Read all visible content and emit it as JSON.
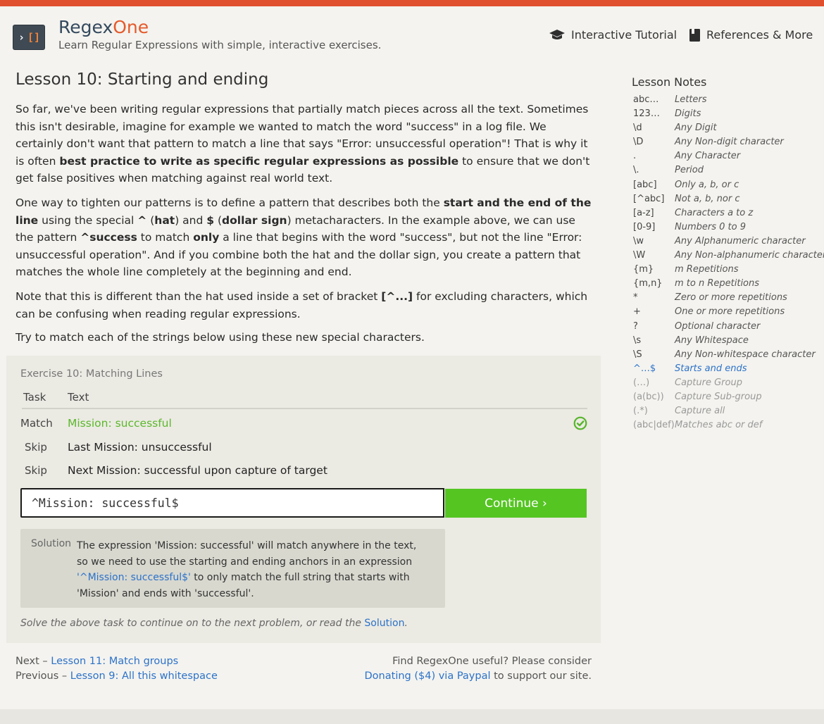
{
  "header": {
    "brand_main": "Regex",
    "brand_accent": "One",
    "tagline": "Learn Regular Expressions with simple, interactive exercises.",
    "nav": {
      "tutorial": "Interactive Tutorial",
      "references": "References & More"
    }
  },
  "lesson": {
    "title": "Lesson 10: Starting and ending",
    "p1": {
      "a": "So far, we've been writing regular expressions that partially match pieces across all the text. Sometimes this isn't desirable, imagine for example we wanted to match the word \"success\" in a log file. We certainly don't want that pattern to match a line that says \"Error: unsuccessful operation\"! That is why it is often ",
      "b": "best practice to write as specific regular expressions as possible",
      "c": " to ensure that we don't get false positives when matching against real world text."
    },
    "p2": {
      "a": "One way to tighten our patterns is to define a pattern that describes both the ",
      "b": "start and the end of the line",
      "c": " using the special ",
      "d": "^",
      "e": " (",
      "f": "hat",
      "g": ") and ",
      "h": "$",
      "i": " (",
      "j": "dollar sign",
      "k": ") metacharacters. In the example above, we can use the pattern ",
      "l": "^success",
      "m": " to match ",
      "n": "only",
      "o": " a line that begins with the word \"success\", but not the line \"Error: unsuccessful operation\". And if you combine both the hat and the dollar sign, you create a pattern that matches the whole line completely at the beginning and end."
    },
    "p3": {
      "a": "Note that this is different than the hat used inside a set of bracket ",
      "b": "[^...]",
      "c": " for excluding characters, which can be confusing when reading regular expressions."
    },
    "p4": "Try to match each of the strings below using these new special characters."
  },
  "exercise": {
    "title": "Exercise 10: Matching Lines",
    "col_task": "Task",
    "col_text": "Text",
    "rows": [
      {
        "task": "Match",
        "text": "Mission: successful",
        "status": "matched"
      },
      {
        "task": "Skip",
        "text": "Last Mission: unsuccessful"
      },
      {
        "task": "Skip",
        "text": "Next Mission: successful upon capture of target"
      }
    ],
    "input_value": "^Mission: successful$",
    "continue_label": "Continue ›",
    "solution": {
      "label": "Solution",
      "a": "The expression 'Mission: successful' will match anywhere in the text, so we need to use the starting and ending anchors in an expression ",
      "code": "'^Mission: successful$'",
      "b": " to only match the full string that starts with 'Mission' and ends with 'successful'."
    },
    "hint_text": "Solve the above task to continue on to the next problem, or read the ",
    "hint_link": "Solution",
    "hint_end": "."
  },
  "footer": {
    "next_prefix": "Next – ",
    "next_link": "Lesson 11: Match groups",
    "prev_prefix": "Previous – ",
    "prev_link": "Lesson 9: All this whitespace",
    "donate_line1": "Find RegexOne useful? Please consider",
    "donate_link": "Donating ($4) via Paypal",
    "donate_suffix": " to support our site."
  },
  "notes": {
    "title": "Lesson Notes",
    "items": [
      {
        "k": "abc…",
        "v": "Letters",
        "state": "normal"
      },
      {
        "k": "123…",
        "v": "Digits",
        "state": "normal"
      },
      {
        "k": "\\d",
        "v": "Any Digit",
        "state": "normal"
      },
      {
        "k": "\\D",
        "v": "Any Non-digit character",
        "state": "normal"
      },
      {
        "k": ".",
        "v": "Any Character",
        "state": "normal"
      },
      {
        "k": "\\.",
        "v": "Period",
        "state": "normal"
      },
      {
        "k": "[abc]",
        "v": "Only a, b, or c",
        "state": "normal"
      },
      {
        "k": "[^abc]",
        "v": "Not a, b, nor c",
        "state": "normal"
      },
      {
        "k": "[a-z]",
        "v": "Characters a to z",
        "state": "normal"
      },
      {
        "k": "[0-9]",
        "v": "Numbers 0 to 9",
        "state": "normal"
      },
      {
        "k": "\\w",
        "v": "Any Alphanumeric character",
        "state": "normal"
      },
      {
        "k": "\\W",
        "v": "Any Non-alphanumeric character",
        "state": "normal"
      },
      {
        "k": "{m}",
        "v": "m Repetitions",
        "state": "normal"
      },
      {
        "k": "{m,n}",
        "v": "m to n Repetitions",
        "state": "normal"
      },
      {
        "k": "*",
        "v": "Zero or more repetitions",
        "state": "normal"
      },
      {
        "k": "+",
        "v": "One or more repetitions",
        "state": "normal"
      },
      {
        "k": "?",
        "v": "Optional character",
        "state": "normal"
      },
      {
        "k": "\\s",
        "v": "Any Whitespace",
        "state": "normal"
      },
      {
        "k": "\\S",
        "v": "Any Non-whitespace character",
        "state": "normal"
      },
      {
        "k": "^…$",
        "v": "Starts and ends",
        "state": "active"
      },
      {
        "k": "(…)",
        "v": "Capture Group",
        "state": "future"
      },
      {
        "k": "(a(bc))",
        "v": "Capture Sub-group",
        "state": "future"
      },
      {
        "k": "(.*)",
        "v": "Capture all",
        "state": "future"
      },
      {
        "k": "(abc|def)",
        "v": "Matches abc or def",
        "state": "future"
      }
    ]
  },
  "colors": {
    "accent_bar": "#e04f2e",
    "brand_accent": "#e45a2c",
    "success_green": "#55c522",
    "link_blue": "#2c72c9"
  },
  "icons": {
    "logo": "regex-logo-icon",
    "tutorial": "graduation-cap-icon",
    "references": "book-icon",
    "matched": "check-circle-icon"
  }
}
